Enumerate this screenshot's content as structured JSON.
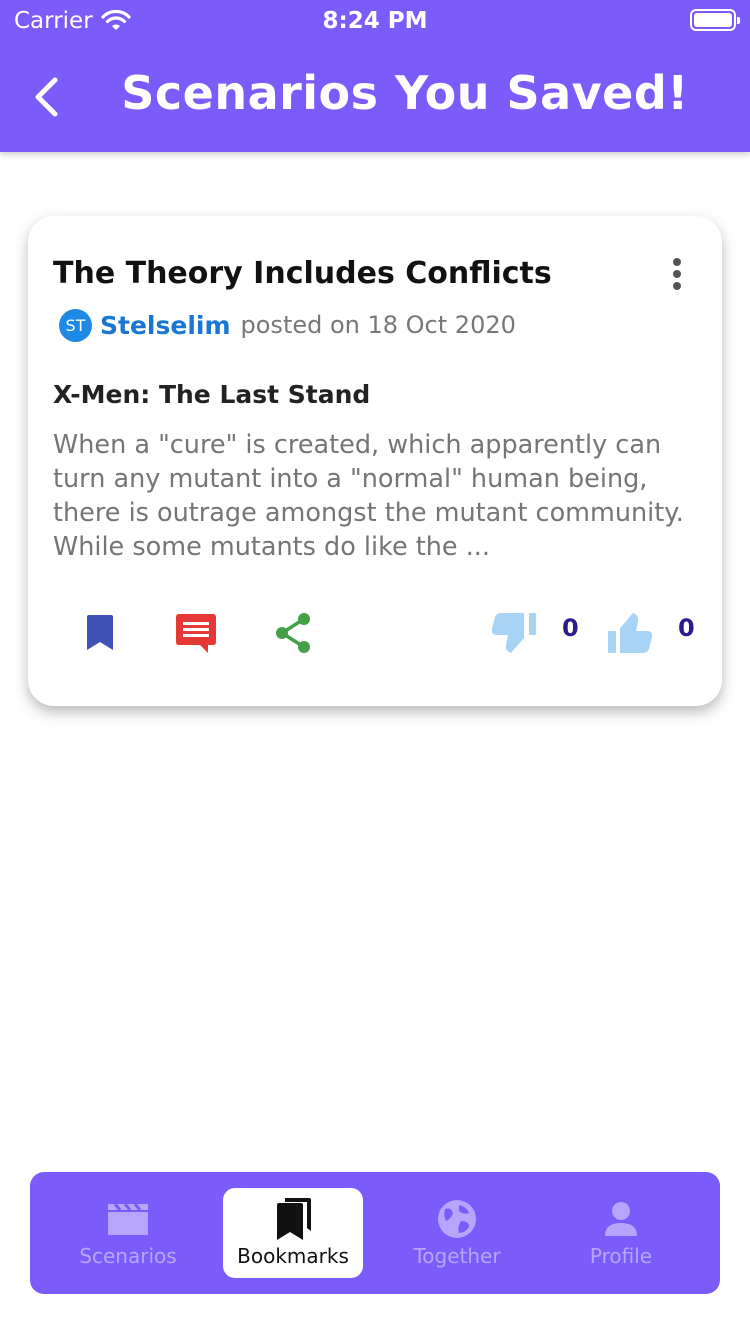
{
  "status_bar": {
    "carrier": "Carrier",
    "time": "8:24 PM"
  },
  "header": {
    "title": "Scenarios You Saved!"
  },
  "card": {
    "title": "The Theory Includes Conflicts",
    "author_initials": "ST",
    "author": "Stelselim",
    "posted": "posted on 18 Oct 2020",
    "movie": "X-Men: The Last Stand",
    "description": "When a \"cure\" is created, which apparently can turn any mutant into a \"normal\" human being, there is outrage amongst the mutant community. While some mutants do like the ...",
    "dislikes": "0",
    "likes": "0"
  },
  "bottom_nav": {
    "items": [
      {
        "label": "Scenarios",
        "icon": "clapperboard-icon"
      },
      {
        "label": "Bookmarks",
        "icon": "bookmarks-icon",
        "active": true
      },
      {
        "label": "Together",
        "icon": "globe-icon"
      },
      {
        "label": "Profile",
        "icon": "person-icon"
      }
    ]
  },
  "colors": {
    "primary": "#7B5CFA",
    "author": "#1976D2",
    "bookmark": "#3F51B5",
    "comment": "#E53935",
    "share": "#43A047",
    "thumb": "#A7D4F5",
    "count": "#2A1B8F"
  }
}
